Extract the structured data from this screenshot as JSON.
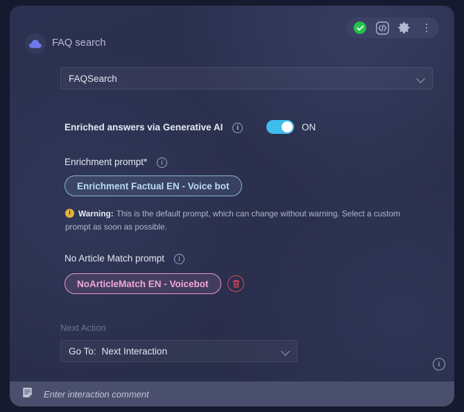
{
  "header": {
    "title": "FAQ search",
    "logo_icon": "cloud-icon"
  },
  "toolbar": {
    "status_icon": "check-circle-icon",
    "code_icon": "code-brackets-icon",
    "settings_icon": "gear-icon",
    "more_icon": "more-vertical-icon",
    "status_color": "#24c24a",
    "background": "#3c4265"
  },
  "node_select": {
    "value": "FAQSearch",
    "chevron_icon": "chevron-down-icon"
  },
  "enrichment_toggle": {
    "label": "Enriched answers via Generative AI",
    "info_icon": "info-icon",
    "state_label": "ON",
    "on": true,
    "accent_color": "#3fbdee"
  },
  "enrichment_prompt": {
    "label": "Enrichment prompt*",
    "info_icon": "info-icon",
    "chip": "Enrichment Factual EN - Voice bot",
    "chip_color": "#b9dcf3"
  },
  "warning": {
    "icon": "warning-info-icon",
    "title": "Warning:",
    "text": "This is the default prompt, which can change without warning. Select a custom prompt as soon as possible.",
    "color": "#e4b23c"
  },
  "no_article_match": {
    "label": "No Article Match prompt",
    "info_icon": "info-icon",
    "chip": "NoArticleMatch EN - Voicebot",
    "chip_color": "#f2a8da",
    "delete_icon": "trash-icon",
    "delete_color": "#e0465b"
  },
  "next_action": {
    "label": "Next Action",
    "lead": "Go To:",
    "value": "Next Interaction",
    "chevron_icon": "chevron-down-icon"
  },
  "footer": {
    "info_icon": "info-icon",
    "note_icon": "note-icon",
    "comment_placeholder": "Enter interaction comment"
  }
}
